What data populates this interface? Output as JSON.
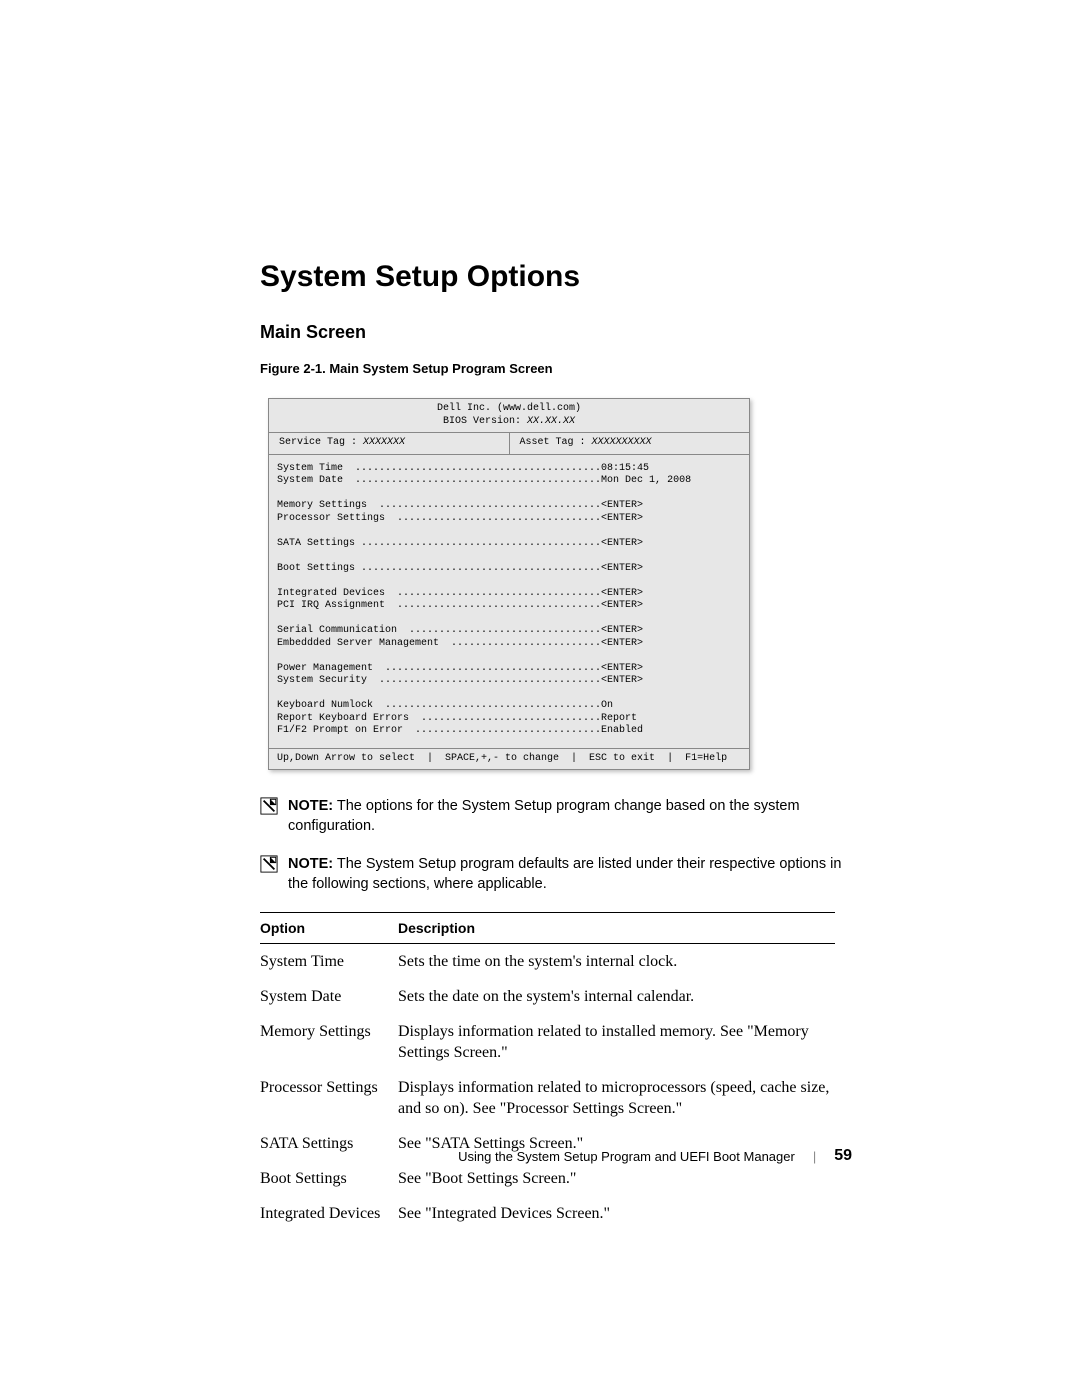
{
  "headings": {
    "section": "System Setup Options",
    "subhead": "Main Screen",
    "figure": "Figure 2-1.    Main System Setup Program Screen"
  },
  "bios": {
    "header_line1": "Dell Inc. (www.dell.com)",
    "header_line2_prefix": "BIOS Version: ",
    "header_line2_em": "XX.XX.XX",
    "service_tag_label": "Service Tag : ",
    "service_tag_value": "XXXXXXX",
    "asset_tag_label": "Asset Tag : ",
    "asset_tag_value": "XXXXXXXXXX",
    "body_lines": [
      "System Time  .........................................08:15:45",
      "System Date  .........................................Mon Dec 1, 2008",
      "",
      "Memory Settings  .....................................<ENTER>",
      "Processor Settings  ..................................<ENTER>",
      "",
      "SATA Settings ........................................<ENTER>",
      "",
      "Boot Settings ........................................<ENTER>",
      "",
      "Integrated Devices  ..................................<ENTER>",
      "PCI IRQ Assignment  ..................................<ENTER>",
      "",
      "Serial Communication  ................................<ENTER>",
      "Embeddded Server Management  .........................<ENTER>",
      "",
      "Power Management  ....................................<ENTER>",
      "System Security  .....................................<ENTER>",
      "",
      "Keyboard Numlock  ....................................On",
      "Report Keyboard Errors  ..............................Report",
      "F1/F2 Prompt on Error  ...............................Enabled"
    ],
    "keys_line": "Up,Down Arrow to select  |  SPACE,+,- to change  |  ESC to exit  |  F1=Help"
  },
  "notes": {
    "label": "NOTE:",
    "note1": " The options for the System Setup program change based on the system configuration.",
    "note2": " The System Setup program defaults are listed under their respective options in the following sections, where applicable."
  },
  "table": {
    "head_option": "Option",
    "head_desc": "Description",
    "rows": [
      {
        "opt": "System Time",
        "desc": "Sets the time on the system's internal clock."
      },
      {
        "opt": "System Date",
        "desc": "Sets the date on the system's internal calendar."
      },
      {
        "opt": "Memory Settings",
        "desc": "Displays information related to installed memory. See \"Memory Settings Screen.\""
      },
      {
        "opt": "Processor Settings",
        "desc": "Displays information related to microprocessors (speed, cache size, and so on). See \"Processor Settings Screen.\""
      },
      {
        "opt": "SATA Settings",
        "desc": "See \"SATA Settings Screen.\""
      },
      {
        "opt": "Boot Settings",
        "desc": "See \"Boot Settings Screen.\""
      },
      {
        "opt": "Integrated Devices",
        "desc": "See \"Integrated Devices Screen.\""
      }
    ]
  },
  "footer": {
    "text": "Using the System Setup Program and UEFI Boot Manager",
    "page": "59"
  }
}
